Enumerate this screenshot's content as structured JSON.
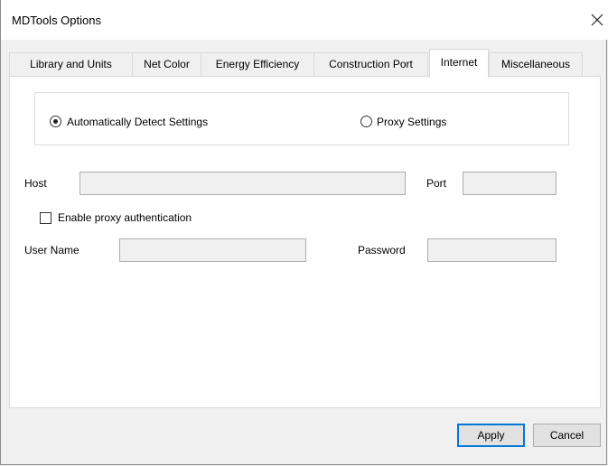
{
  "window": {
    "title": "MDTools Options",
    "close_icon": "close-icon"
  },
  "tabs": [
    {
      "label": "Library and Units",
      "active": false
    },
    {
      "label": "Net Color",
      "active": false
    },
    {
      "label": "Energy Efficiency",
      "active": false
    },
    {
      "label": "Construction Port",
      "active": false
    },
    {
      "label": "Internet",
      "active": true
    },
    {
      "label": "Miscellaneous",
      "active": false
    }
  ],
  "connection": {
    "auto_detect_label": "Automatically Detect Settings",
    "auto_detect_selected": true,
    "proxy_label": "Proxy Settings",
    "proxy_selected": false
  },
  "proxy": {
    "host_label": "Host",
    "host_value": "",
    "port_label": "Port",
    "port_value": "",
    "auth_label": "Enable proxy authentication",
    "auth_checked": false,
    "username_label": "User Name",
    "username_value": "",
    "password_label": "Password",
    "password_value": ""
  },
  "buttons": {
    "apply": "Apply",
    "cancel": "Cancel"
  }
}
